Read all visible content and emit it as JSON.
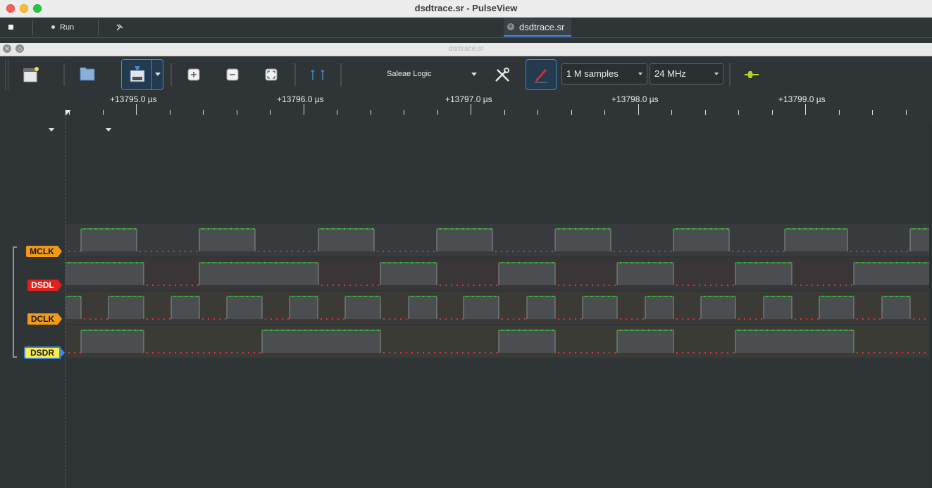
{
  "window": {
    "title": "dsdtrace.sr - PulseView"
  },
  "mainbar": {
    "run_label": "Run",
    "tab_label": "dsdtrace.sr"
  },
  "subwindow": {
    "title": "dsdtrace.sr"
  },
  "toolbar": {
    "device": "Saleae Logic",
    "samples": "1 M samples",
    "samplerate": "24 MHz"
  },
  "ruler": {
    "labels": [
      "+13795.0 µs",
      "+13796.0 µs",
      "+13797.0 µs",
      "+13798.0 µs",
      "+13799.0 µs"
    ]
  },
  "channels": [
    {
      "name": "MCLK",
      "color": "#f29a16",
      "high_segments": [
        [
          115,
          194
        ],
        [
          283,
          362
        ],
        [
          452,
          531
        ],
        [
          620,
          699
        ],
        [
          788,
          867
        ],
        [
          956,
          1035
        ],
        [
          1114,
          1203
        ],
        [
          1292,
          1319
        ]
      ]
    },
    {
      "name": "DSDL",
      "color": "#e0211c",
      "high_segments": [
        [
          93,
          204
        ],
        [
          283,
          452
        ],
        [
          540,
          620
        ],
        [
          708,
          788
        ],
        [
          876,
          956
        ],
        [
          1044,
          1124
        ],
        [
          1212,
          1319
        ]
      ]
    },
    {
      "name": "DCLK",
      "color": "#f29a16",
      "high_segments": [
        [
          93,
          115
        ],
        [
          154,
          204
        ],
        [
          243,
          283
        ],
        [
          322,
          372
        ],
        [
          411,
          451
        ],
        [
          490,
          540
        ],
        [
          580,
          620
        ],
        [
          658,
          708
        ],
        [
          748,
          788
        ],
        [
          827,
          876
        ],
        [
          916,
          956
        ],
        [
          995,
          1044
        ],
        [
          1084,
          1124
        ],
        [
          1163,
          1212
        ],
        [
          1252,
          1292
        ]
      ]
    },
    {
      "name": "DSDR",
      "color": "#fcee4c",
      "high_segments": [
        [
          115,
          204
        ],
        [
          372,
          540
        ],
        [
          708,
          788
        ],
        [
          876,
          956
        ],
        [
          1044,
          1212
        ]
      ]
    }
  ],
  "colors": {
    "background": "#2f3437",
    "signal_high": "#3fbf3f",
    "signal_low": "#d63a3a",
    "accent": "#3f8bd6"
  }
}
